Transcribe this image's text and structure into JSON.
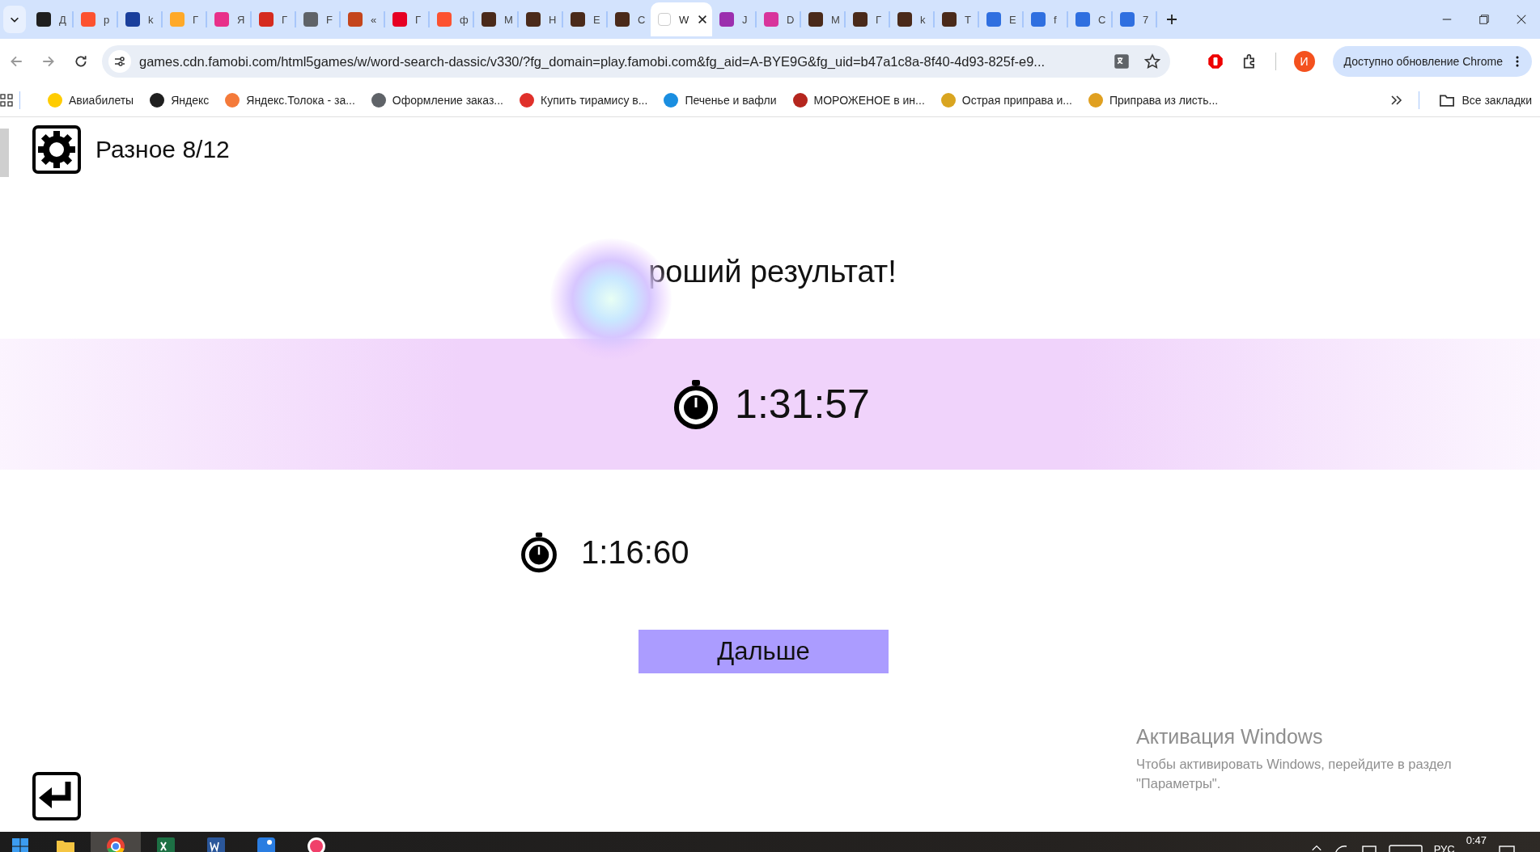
{
  "tabs": [
    {
      "letter": "Д",
      "color": "#1f1f1f",
      "selected": false
    },
    {
      "letter": "р",
      "color": "#fc5230",
      "selected": false
    },
    {
      "letter": "k",
      "color": "#1a3f9c",
      "selected": false
    },
    {
      "letter": "Г",
      "color": "#ffa928",
      "selected": false
    },
    {
      "letter": "Я",
      "color": "#e8308a",
      "selected": false
    },
    {
      "letter": "Г",
      "color": "#d52b1e",
      "selected": false
    },
    {
      "letter": "F",
      "color": "#5f6368",
      "selected": false
    },
    {
      "letter": "«",
      "color": "#c4451c",
      "selected": false
    },
    {
      "letter": "Г",
      "color": "#e60023",
      "selected": false
    },
    {
      "letter": "ф",
      "color": "#fc5230",
      "selected": false
    },
    {
      "letter": "M",
      "color": "#4a2a1a",
      "selected": false
    },
    {
      "letter": "H",
      "color": "#4a2a1a",
      "selected": false
    },
    {
      "letter": "E",
      "color": "#4a2a1a",
      "selected": false
    },
    {
      "letter": "C",
      "color": "#4a2a1a",
      "selected": false
    },
    {
      "letter": "W",
      "color": "#ffffff",
      "selected": true
    },
    {
      "letter": "J",
      "color": "#9b2fae",
      "selected": false
    },
    {
      "letter": "D",
      "color": "#d8349c",
      "selected": false
    },
    {
      "letter": "M",
      "color": "#4a2a1a",
      "selected": false
    },
    {
      "letter": "Г",
      "color": "#4a2a1a",
      "selected": false
    },
    {
      "letter": "k",
      "color": "#4a2a1a",
      "selected": false
    },
    {
      "letter": "T",
      "color": "#4a2a1a",
      "selected": false
    },
    {
      "letter": "E",
      "color": "#2f6fe0",
      "selected": false
    },
    {
      "letter": "f",
      "color": "#2f6fe0",
      "selected": false
    },
    {
      "letter": "C",
      "color": "#2f6fe0",
      "selected": false
    },
    {
      "letter": "7",
      "color": "#2f6fe0",
      "selected": false
    }
  ],
  "toolbar": {
    "url": "games.cdn.famobi.com/html5games/w/word-search-dassic/v330/?fg_domain=play.famobi.com&fg_aid=A-BYE9G&fg_uid=b47a1c8a-8f40-4d93-825f-e9...",
    "profile": "И",
    "update_button": "Доступно обновление Chrome"
  },
  "bookmarks": [
    {
      "label": "Авиабилеты",
      "color": "#ffcc00"
    },
    {
      "label": "Яндекс",
      "color": "#1f1f1f"
    },
    {
      "label": "Яндекс.Толока - за...",
      "color": "#f47a3a"
    },
    {
      "label": "Оформление заказ...",
      "color": "#5f6368"
    },
    {
      "label": "Купить тирамису в...",
      "color": "#e0302a"
    },
    {
      "label": "Печенье и вафли",
      "color": "#1a8ee0"
    },
    {
      "label": "МОРОЖЕНОЕ в ин...",
      "color": "#b5261e"
    },
    {
      "label": "Острая приправа и...",
      "color": "#d9a520"
    },
    {
      "label": "Приправа из листь...",
      "color": "#e0a020"
    }
  ],
  "all_bookmarks": "Все закладки",
  "game": {
    "level_title": "Разное 8/12",
    "result_title": "роший результат!",
    "time": "1:31:57",
    "best_time": "1:16:60",
    "next_button": "Дальше"
  },
  "watermark": {
    "title": "Активация Windows",
    "text": "Чтобы активировать Windows, перейдите в раздел \"Параметры\"."
  },
  "taskbar": {
    "apps": [
      {
        "kind": "folder",
        "selected": false
      },
      {
        "kind": "chrome",
        "selected": true
      },
      {
        "kind": "excel",
        "selected": false
      },
      {
        "kind": "word",
        "selected": false
      },
      {
        "kind": "photos",
        "selected": false
      },
      {
        "kind": "music",
        "selected": false
      }
    ],
    "language": "РУС",
    "clock": "0:47"
  }
}
